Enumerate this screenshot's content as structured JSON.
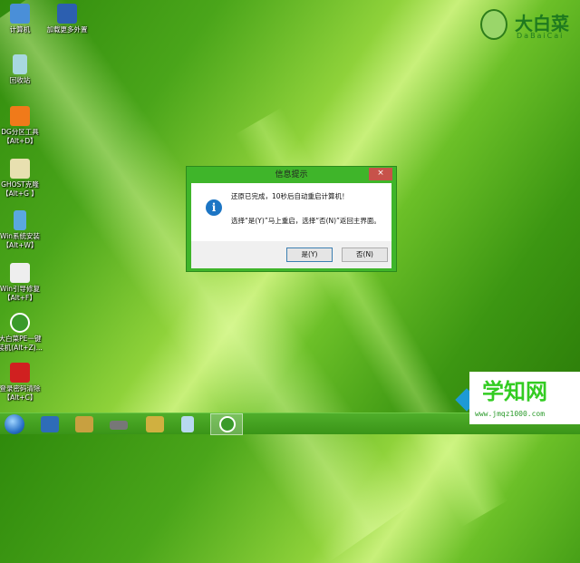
{
  "desktop": {
    "icons": [
      {
        "label": "计算机",
        "icon": "computer-icon",
        "color": "#4a8fd8"
      },
      {
        "label": "加载更多外置",
        "icon": "expand-icon",
        "color": "#2c5fb0"
      },
      {
        "label": "回收站",
        "icon": "recycle-bin-icon",
        "color": "#a8d8e0"
      },
      {
        "label": "DG分区工具\n【Alt+D】",
        "l1": "DG分区工具",
        "l2": "【Alt+D】",
        "icon": "diskgenius-icon",
        "color": "#f07a1a"
      },
      {
        "l1": "GHOST克隆",
        "l2": "【Alt+G 】",
        "icon": "ghost-icon",
        "color": "#e8e0b0"
      },
      {
        "l1": "Win系统安装",
        "l2": "【Alt+W】",
        "icon": "windows-install-icon",
        "color": "#5aa8e0"
      },
      {
        "l1": "Win引导修复",
        "l2": "【Alt+F】",
        "icon": "boot-repair-icon",
        "color": "#eeeeee"
      },
      {
        "l1": "大白菜PE一键",
        "l2": "装机(Alt+Z)...",
        "icon": "dabaicai-install-icon",
        "color": "#3a9a2a"
      },
      {
        "l1": "登录密码清除",
        "l2": "【Alt+C】",
        "icon": "password-clear-icon",
        "color": "#d02020"
      }
    ]
  },
  "logo": {
    "cn": "大白菜",
    "en": "DaBaiCai"
  },
  "dialog": {
    "title": "信息提示",
    "close": "×",
    "line1": "还原已完成，10秒后自动重启计算机！",
    "line2": "选择“是(Y)”马上重启，选择“否(N)”返回主界面。",
    "yes": "是(Y)",
    "no": "否(N)",
    "icon": "info-icon"
  },
  "taskbar": {
    "items": [
      "start-button",
      "desktop-icon",
      "cleaner-icon",
      "memory-icon",
      "image-tool-icon",
      "notepad-icon",
      "dabaicai-icon"
    ]
  },
  "watermark": {
    "title": "学知网",
    "url": "www.jmqz1000.com"
  }
}
